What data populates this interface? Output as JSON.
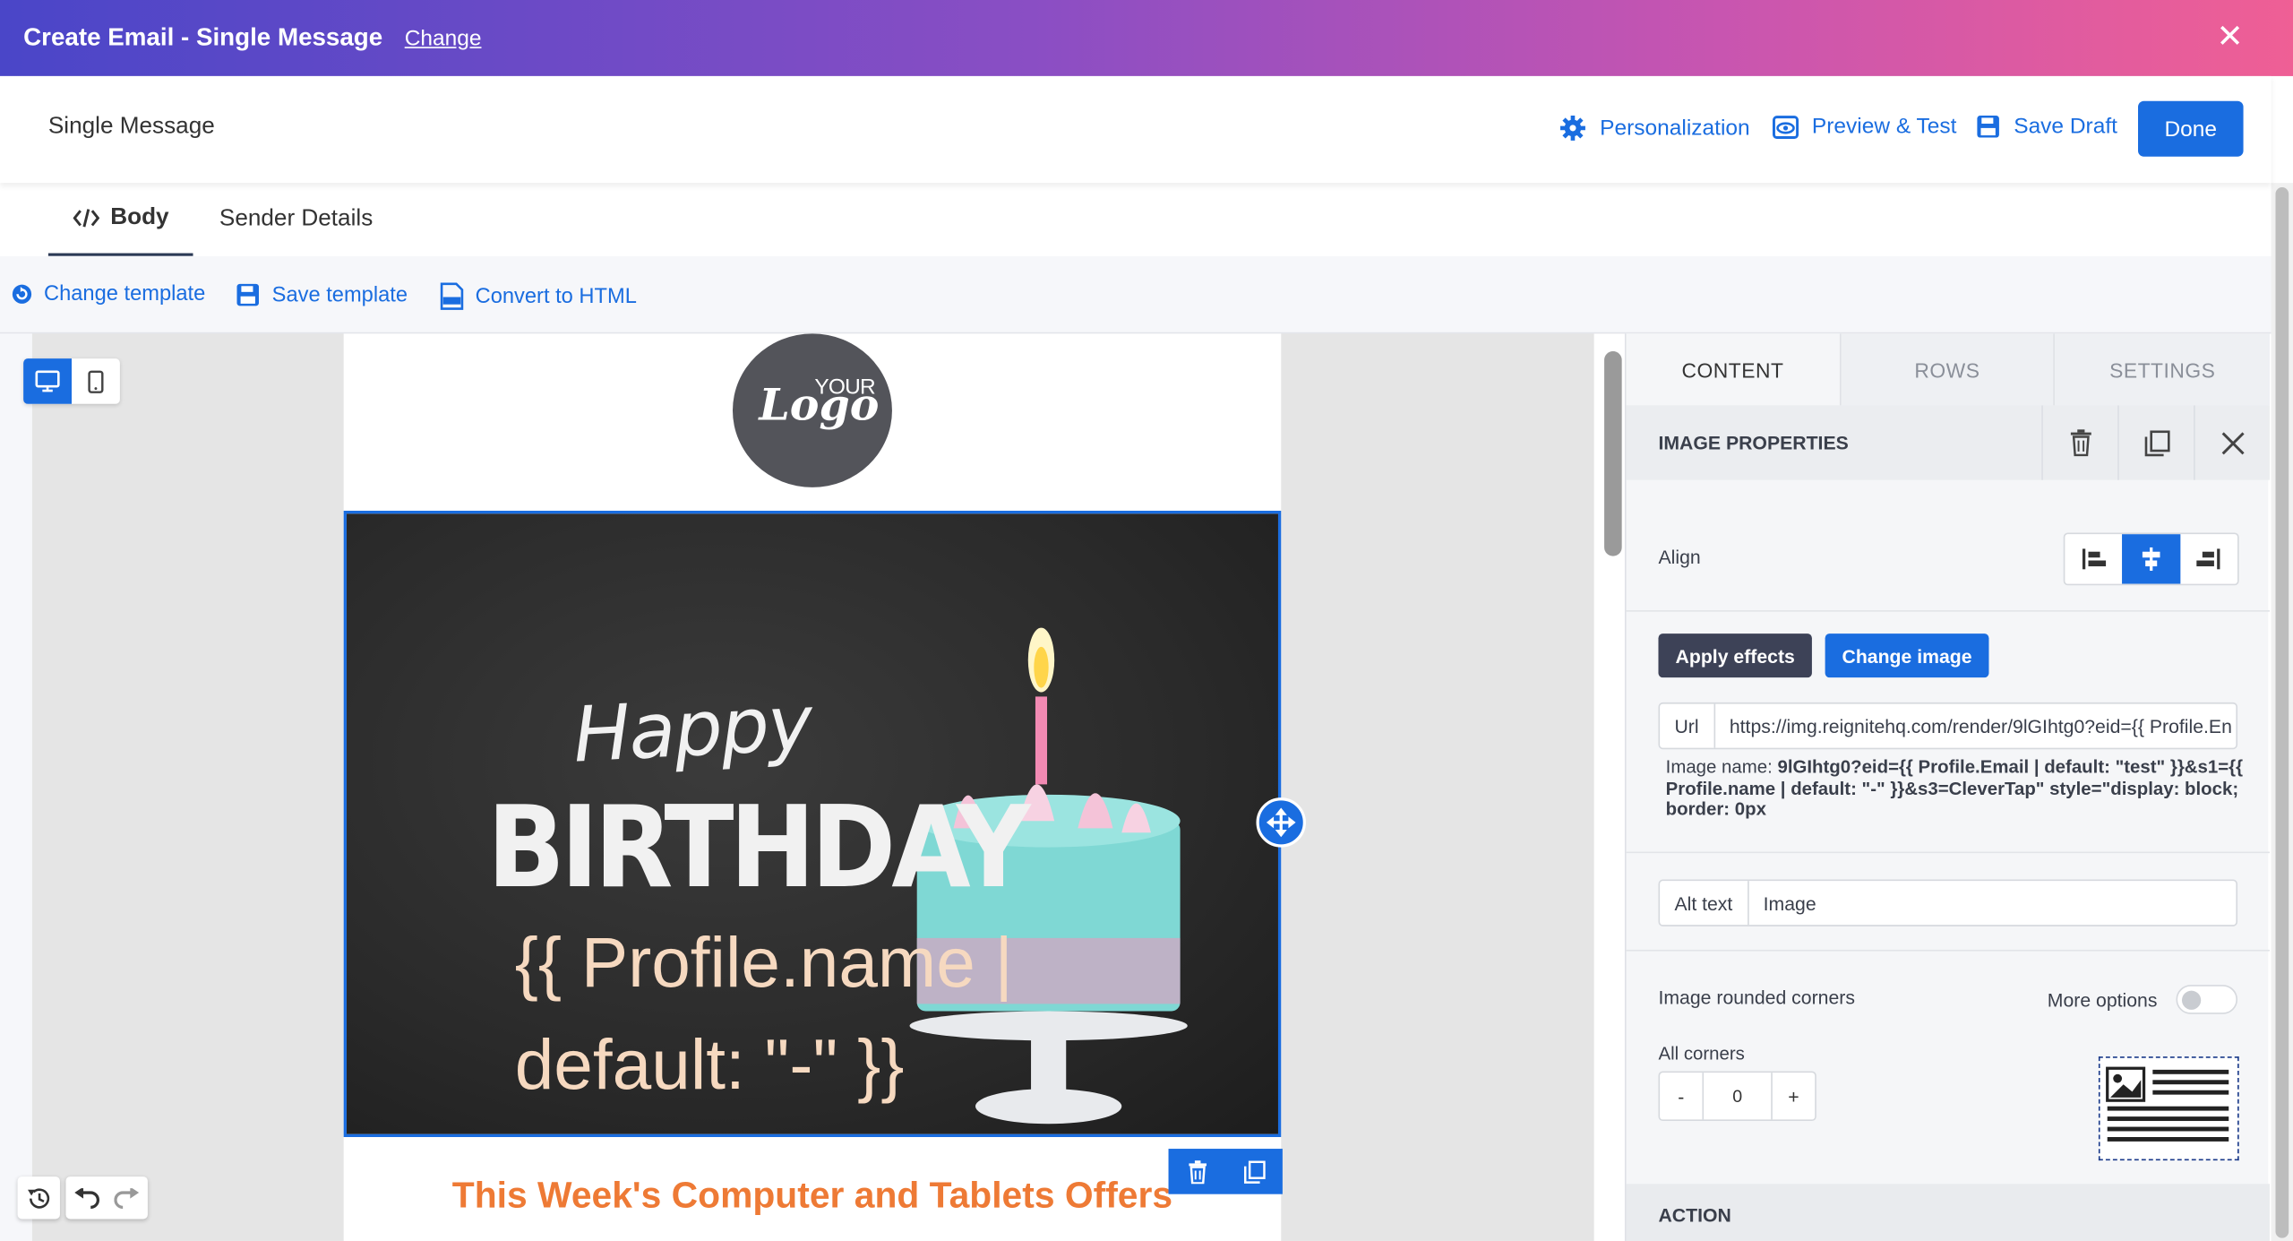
{
  "topbar": {
    "title": "Create Email - Single Message",
    "change_label": "Change",
    "close_glyph": "✕"
  },
  "header": {
    "page_title": "Single Message",
    "personalization": "Personalization",
    "preview": "Preview & Test",
    "save_draft": "Save Draft",
    "done": "Done"
  },
  "tabs": {
    "body": "Body",
    "sender": "Sender Details"
  },
  "toolbar": {
    "change_template": "Change template",
    "save_template": "Save template",
    "convert_html": "Convert to HTML"
  },
  "email": {
    "logo_your": "YOUR",
    "logo_text": "Logo",
    "hero_happy": "Happy",
    "hero_birthday": "BIRTHDAY",
    "hero_profile_line1": "{{ Profile.name |",
    "hero_profile_line2": "default: \"-\" }}",
    "offers_heading": "This Week's Computer and Tablets Offers"
  },
  "panel": {
    "tabs": [
      "CONTENT",
      "ROWS",
      "SETTINGS"
    ],
    "section_title": "IMAGE PROPERTIES",
    "align_label": "Align",
    "apply_effects": "Apply effects",
    "change_image": "Change image",
    "url_label": "Url",
    "url_value": "https://img.reignitehq.com/render/9lGIhtg0?eid={{ Profile.En",
    "image_name_label": "Image name:",
    "image_name_value": "9lGIhtg0?eid={{ Profile.Email | default: \"test\" }}&s1={{ Profile.name | default: \"-\" }}&s3=CleverTap\" style=\"display: block; border: 0px",
    "alt_label": "Alt text",
    "alt_value": "Image",
    "rounded_label": "Image rounded corners",
    "more_options": "More options",
    "all_corners": "All corners",
    "minus": "-",
    "corner_value": "0",
    "plus": "+",
    "action_title": "ACTION"
  },
  "colors": {
    "accent": "#1a6de0",
    "offers": "#ee7a35",
    "dark_button": "#3d4257"
  }
}
